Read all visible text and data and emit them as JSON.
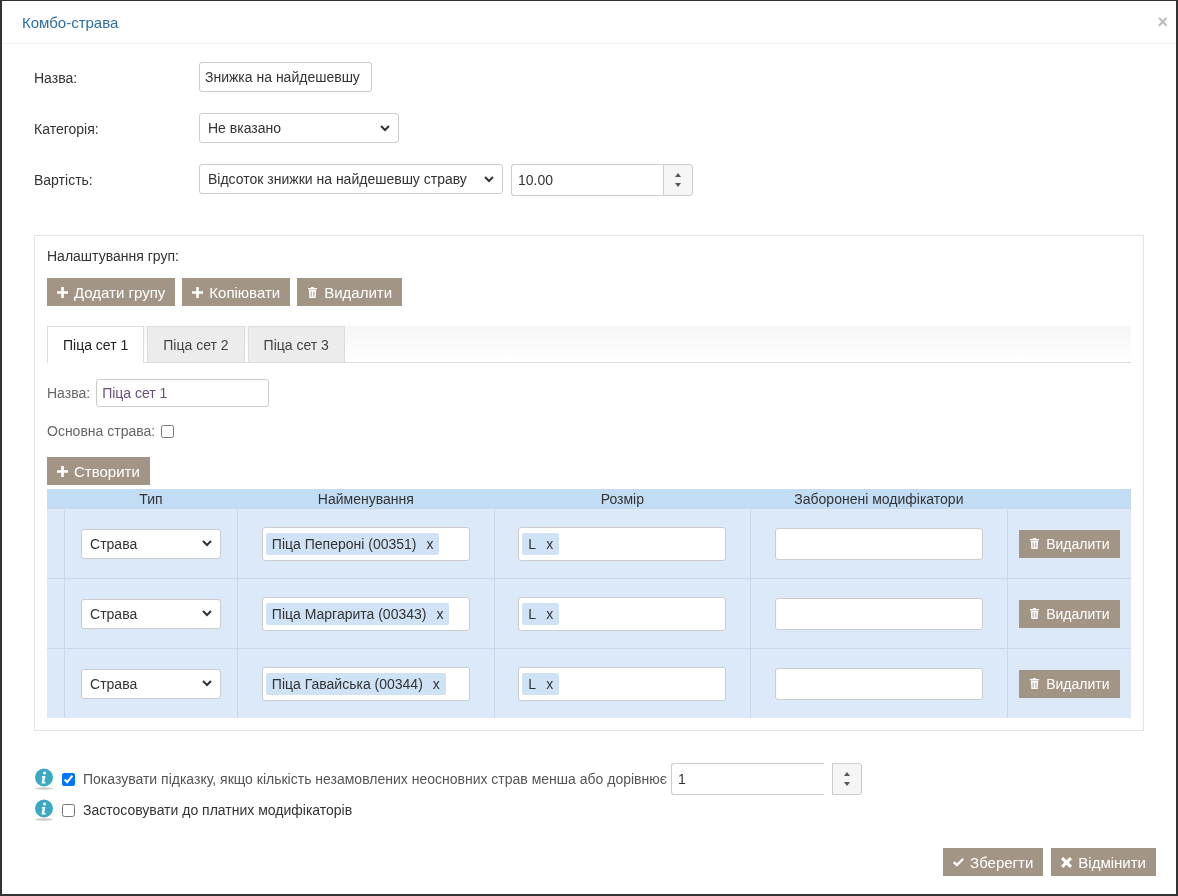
{
  "dialog": {
    "title": "Комбо-страва",
    "close": "×"
  },
  "form": {
    "name": {
      "label": "Назва:",
      "value": "Знижка на найдешевшу"
    },
    "category": {
      "label": "Категорія:",
      "value": "Не вказано"
    },
    "cost": {
      "label": "Вартість:",
      "type": "Відсоток знижки на найдешевшу страву",
      "amount": "10.00"
    }
  },
  "groups": {
    "title": "Налаштування груп:",
    "buttons": [
      {
        "kind": "plus",
        "label": "Додати групу"
      },
      {
        "kind": "plus",
        "label": "Копіювати"
      },
      {
        "kind": "trash",
        "label": "Видалити"
      }
    ],
    "tabs": [
      {
        "label": "Піца сет 1",
        "selected": true
      },
      {
        "label": "Піца сет 2",
        "selected": false
      },
      {
        "label": "Піца сет 3",
        "selected": false
      }
    ],
    "name": {
      "label": "Назва:",
      "value": "Піца сет 1"
    },
    "main_dish": {
      "label": "Основна страва:",
      "checked": false
    },
    "create_button": "Створити",
    "table": {
      "columns": [
        "Тип",
        "Найменування",
        "Розмір",
        "Заборонені модифікатори"
      ],
      "rows": [
        {
          "type": "Страва",
          "name": "Піца Пепероні (00351)",
          "name_remove": "x",
          "size": "L",
          "size_remove": "x",
          "delete": "Видалити"
        },
        {
          "type": "Страва",
          "name": "Піца Маргарита (00343)",
          "name_remove": "x",
          "size": "L",
          "size_remove": "x",
          "delete": "Видалити"
        },
        {
          "type": "Страва",
          "name": "Піца Гавайська (00344)",
          "name_remove": "x",
          "size": "L",
          "size_remove": "x",
          "delete": "Видалити"
        }
      ]
    }
  },
  "options": [
    {
      "label": "Показувати підказку, якщо кількість незамовлених неосновних страв менша або дорівнює",
      "checked": true,
      "value": "1"
    },
    {
      "label": "Застосовувати до платних модифікаторів",
      "checked": false
    }
  ],
  "footer": {
    "buttons": [
      {
        "kind": "check",
        "label": "Зберегти"
      },
      {
        "kind": "cross",
        "label": "Відмінити"
      }
    ]
  }
}
